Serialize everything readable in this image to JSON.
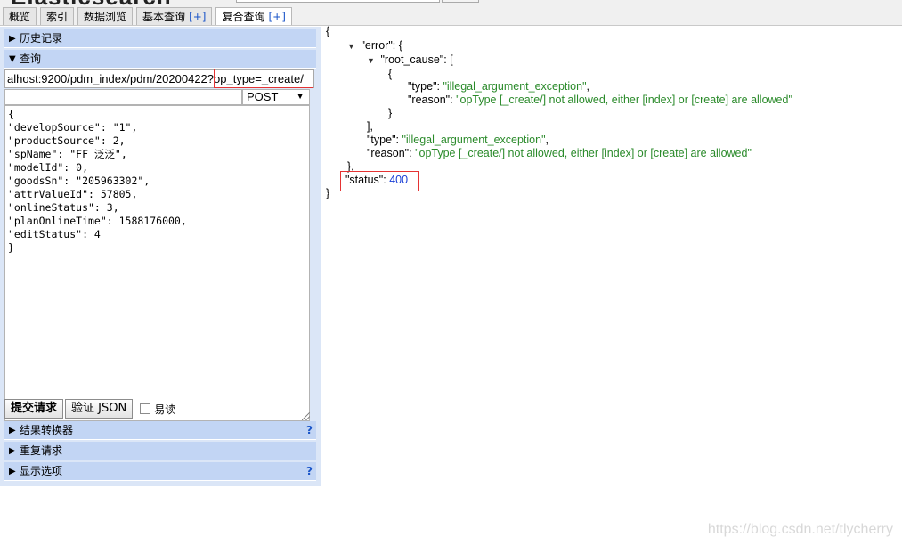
{
  "header": {
    "app_title": "Elasticsearch"
  },
  "tabs": [
    {
      "label": "概览",
      "plus": ""
    },
    {
      "label": "索引",
      "plus": ""
    },
    {
      "label": "数据浏览",
      "plus": ""
    },
    {
      "label": "基本查询",
      "plus": "[+]"
    },
    {
      "label": "复合查询",
      "plus": "[+]",
      "active": true
    }
  ],
  "panels": {
    "history": "历史记录",
    "query": "查询",
    "result_transform": "结果转换器",
    "repeat_request": "重复请求",
    "display_options": "显示选项",
    "help": "?"
  },
  "request": {
    "url": "alhost:9200/pdm_index/pdm/20200422?op_type=_create/",
    "method": "POST",
    "body": "{\n\"developSource\": \"1\",\n\"productSource\": 2,\n\"spName\": \"FF 泛泛\",\n\"modelId\": 0,\n\"goodsSn\": \"205963302\",\n\"attrValueId\": 57805,\n\"onlineStatus\": 3,\n\"planOnlineTime\": 1588176000,\n\"editStatus\": 4\n}"
  },
  "buttons": {
    "submit": "提交请求",
    "validate": "验证 JSON",
    "easy_read": "易读"
  },
  "response": {
    "error_key": "\"error\"",
    "root_cause_key": "\"root_cause\"",
    "type_key": "\"type\"",
    "reason_key": "\"reason\"",
    "status_key": "\"status\"",
    "root_type": "\"illegal_argument_exception\"",
    "root_reason": "\"opType [_create/] not allowed, either [index] or [create] are allowed\"",
    "type": "\"illegal_argument_exception\"",
    "reason": "\"opType [_create/] not allowed, either [index] or [create] are allowed\"",
    "status": "400"
  },
  "watermark": "https://blog.csdn.net/tlycherry",
  "colors": {
    "panel_bg": "#dbe6f7",
    "bar_bg": "#c2d5f4",
    "json_string": "#2a8a2a",
    "json_number": "#1a3fd6",
    "highlight_red": "#e53333"
  }
}
